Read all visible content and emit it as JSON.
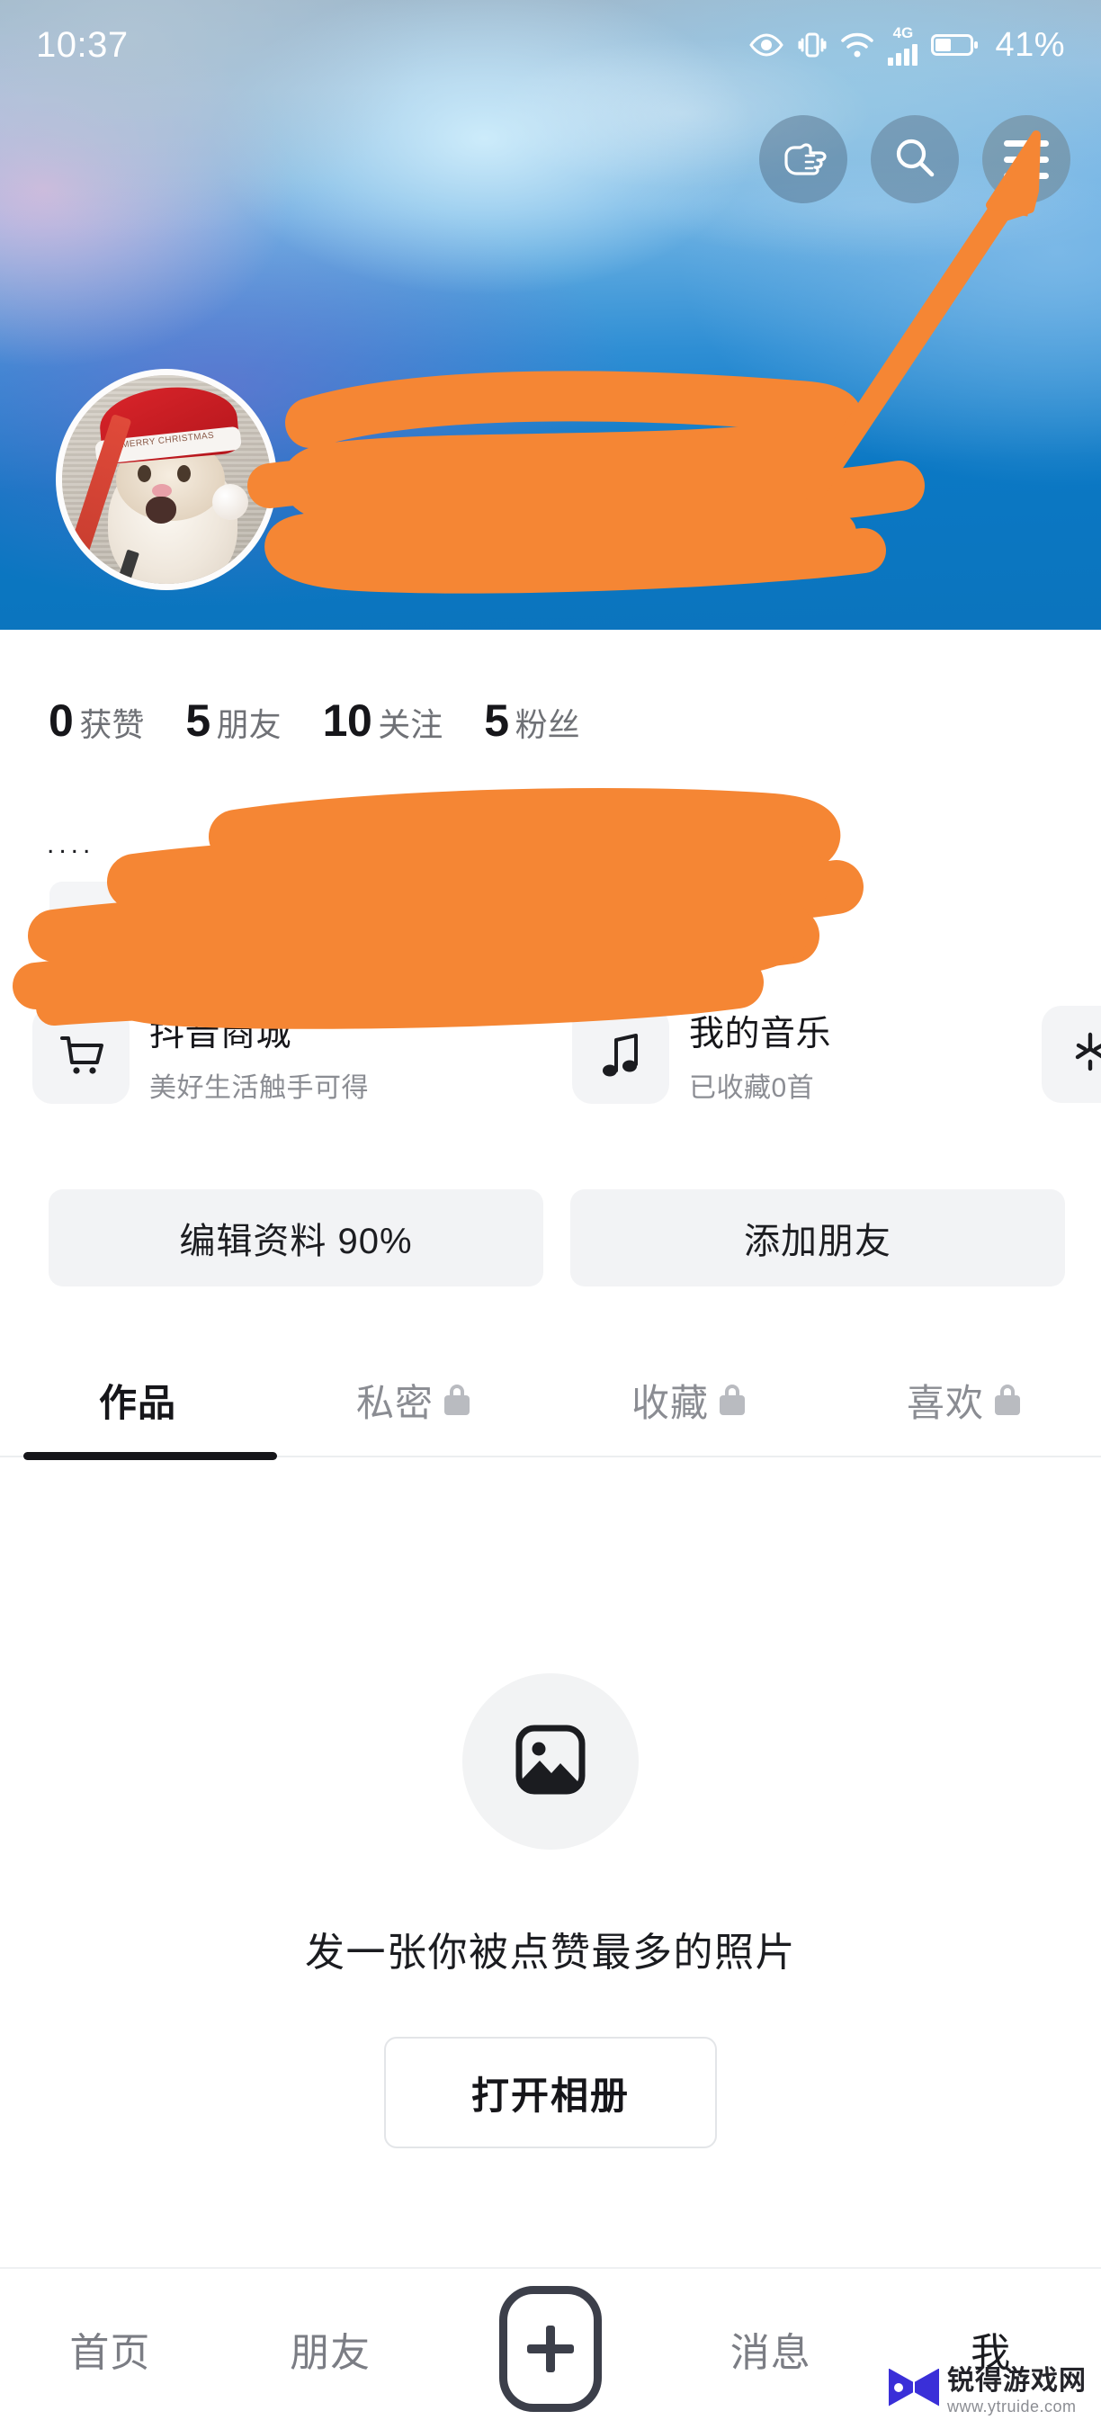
{
  "status_bar": {
    "time": "10:37",
    "battery_percent": "41%",
    "network_type": "4G",
    "icons": [
      "eye-care-icon",
      "vibrate-icon",
      "wifi-icon",
      "signal-icon",
      "battery-icon"
    ]
  },
  "header": {
    "buttons": [
      {
        "name": "pointing-hand-button",
        "icon": "pointing-hand-icon"
      },
      {
        "name": "search-button",
        "icon": "search-icon"
      },
      {
        "name": "menu-button",
        "icon": "hamburger-menu-icon"
      }
    ],
    "avatar_alt": "hamster-with-santa-hat",
    "avatar_hat_text": "MERRY CHRISTMAS",
    "display_name": "",
    "account_id": "",
    "redacted": true
  },
  "stats": [
    {
      "value": "0",
      "label": "获赞"
    },
    {
      "value": "5",
      "label": "朋友"
    },
    {
      "value": "10",
      "label": "关注"
    },
    {
      "value": "5",
      "label": "粉丝"
    }
  ],
  "bio": {
    "dots": "....",
    "redacted": true
  },
  "services": [
    {
      "title": "抖音商城",
      "subtitle": "美好生活触手可得",
      "icon": "shopping-cart-icon"
    },
    {
      "title": "我的音乐",
      "subtitle": "已收藏0首",
      "icon": "music-note-icon"
    },
    {
      "title": "",
      "subtitle": "",
      "icon": "sparkle-icon"
    }
  ],
  "actions": [
    {
      "label": "编辑资料 90%"
    },
    {
      "label": "添加朋友"
    }
  ],
  "tabs": [
    {
      "label": "作品",
      "locked": false,
      "active": true
    },
    {
      "label": "私密",
      "locked": true,
      "active": false
    },
    {
      "label": "收藏",
      "locked": true,
      "active": false
    },
    {
      "label": "喜欢",
      "locked": true,
      "active": false
    }
  ],
  "empty_state": {
    "icon": "image-placeholder-icon",
    "text": "发一张你被点赞最多的照片",
    "button_label": "打开相册"
  },
  "bottom_nav": [
    {
      "label": "首页",
      "active": false
    },
    {
      "label": "朋友",
      "active": false
    },
    {
      "label": "",
      "active": false,
      "icon": "plus-icon"
    },
    {
      "label": "消息",
      "active": false
    },
    {
      "label": "我",
      "active": true
    }
  ],
  "watermark": {
    "name": "锐得游戏网",
    "url": "www.ytruide.com"
  },
  "annotation": {
    "type": "arrow",
    "color": "#F58634",
    "points_to": "menu-button",
    "redaction_color": "#F58634"
  }
}
